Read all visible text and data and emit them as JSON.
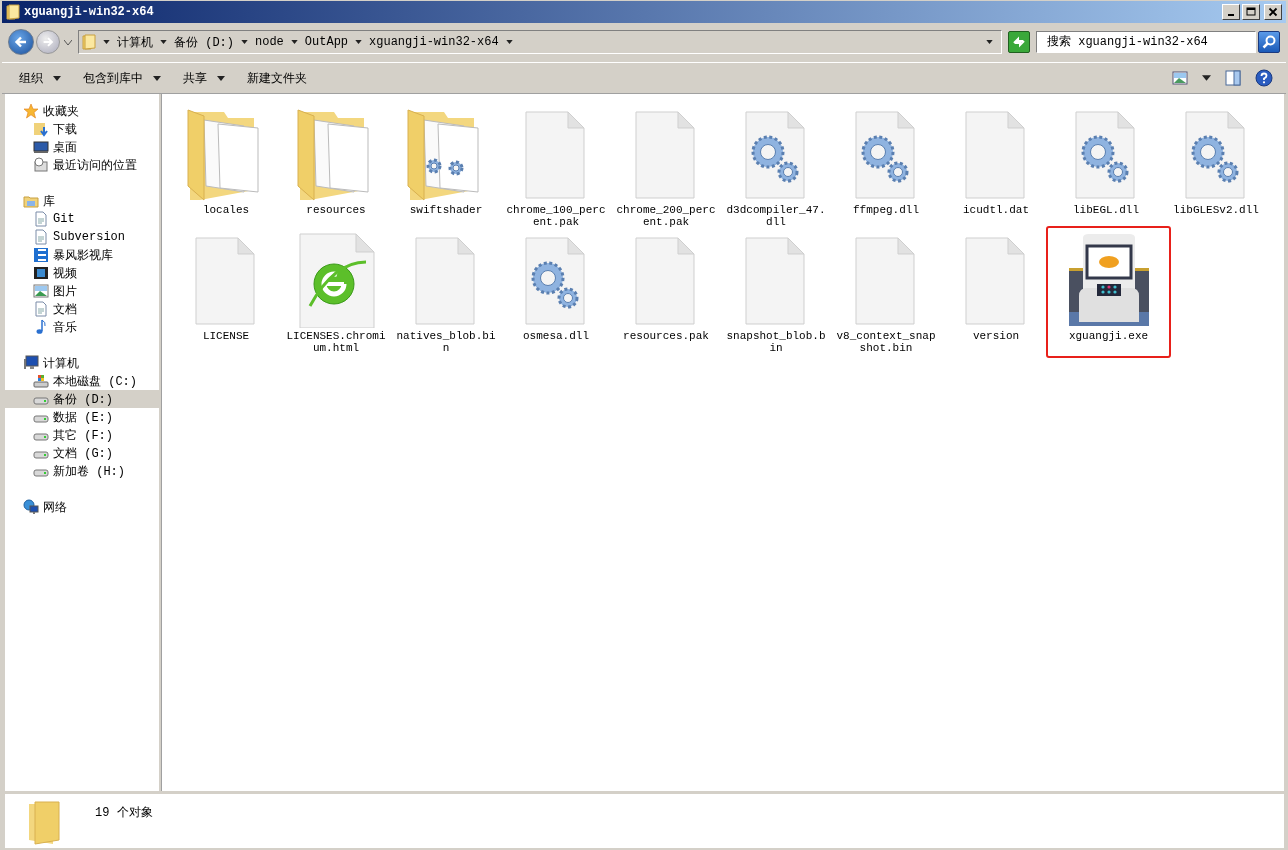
{
  "window": {
    "title": "xguangji-win32-x64"
  },
  "address_bar": {
    "segments": [
      "计算机",
      "备份 (D:)",
      "node",
      "OutApp",
      "xguangji-win32-x64"
    ]
  },
  "search": {
    "placeholder": "搜索 xguangji-win32-x64"
  },
  "toolbar": [
    {
      "label": "组织",
      "has_menu": true
    },
    {
      "label": "包含到库中",
      "has_menu": true
    },
    {
      "label": "共享",
      "has_menu": true
    },
    {
      "label": "新建文件夹",
      "has_menu": false
    }
  ],
  "sidebar": [
    {
      "label": "收藏夹",
      "kind": "star",
      "selected": false,
      "children": [
        {
          "label": "下载",
          "kind": "download",
          "selected": false
        },
        {
          "label": "桌面",
          "kind": "desktop",
          "selected": false
        },
        {
          "label": "最近访问的位置",
          "kind": "recent",
          "selected": false
        }
      ]
    },
    {
      "label": "库",
      "kind": "library",
      "selected": false,
      "children": [
        {
          "label": "Git",
          "kind": "doc",
          "selected": false
        },
        {
          "label": "Subversion",
          "kind": "doc",
          "selected": false
        },
        {
          "label": "暴风影视库",
          "kind": "media",
          "selected": false
        },
        {
          "label": "视频",
          "kind": "video",
          "selected": false
        },
        {
          "label": "图片",
          "kind": "picture",
          "selected": false
        },
        {
          "label": "文档",
          "kind": "doc",
          "selected": false
        },
        {
          "label": "音乐",
          "kind": "music",
          "selected": false
        }
      ]
    },
    {
      "label": "计算机",
      "kind": "computer",
      "selected": false,
      "children": [
        {
          "label": "本地磁盘 (C:)",
          "kind": "system_drive",
          "selected": false
        },
        {
          "label": "备份 (D:)",
          "kind": "drive",
          "selected": true
        },
        {
          "label": "数据 (E:)",
          "kind": "drive",
          "selected": false
        },
        {
          "label": "其它 (F:)",
          "kind": "drive",
          "selected": false
        },
        {
          "label": "文档 (G:)",
          "kind": "drive",
          "selected": false
        },
        {
          "label": "新加卷 (H:)",
          "kind": "drive",
          "selected": false
        }
      ]
    },
    {
      "label": "网络",
      "kind": "network",
      "selected": false
    }
  ],
  "files": [
    {
      "name": "locales",
      "kind": "folder",
      "highlighted": false
    },
    {
      "name": "resources",
      "kind": "folder",
      "highlighted": false
    },
    {
      "name": "swiftshader",
      "kind": "folder_gears",
      "highlighted": false
    },
    {
      "name": "chrome_100_percent.pak",
      "kind": "blank",
      "highlighted": false
    },
    {
      "name": "chrome_200_percent.pak",
      "kind": "blank",
      "highlighted": false
    },
    {
      "name": "d3dcompiler_47.dll",
      "kind": "gears",
      "highlighted": false
    },
    {
      "name": "ffmpeg.dll",
      "kind": "gears",
      "highlighted": false
    },
    {
      "name": "icudtl.dat",
      "kind": "blank",
      "highlighted": false
    },
    {
      "name": "libEGL.dll",
      "kind": "gears",
      "highlighted": false
    },
    {
      "name": "libGLESv2.dll",
      "kind": "gears",
      "highlighted": false
    },
    {
      "name": "LICENSE",
      "kind": "blank",
      "highlighted": false
    },
    {
      "name": "LICENSES.chromium.html",
      "kind": "web",
      "highlighted": false
    },
    {
      "name": "natives_blob.bin",
      "kind": "blank",
      "highlighted": false
    },
    {
      "name": "osmesa.dll",
      "kind": "gears",
      "highlighted": false
    },
    {
      "name": "resources.pak",
      "kind": "blank",
      "highlighted": false
    },
    {
      "name": "snapshot_blob.bin",
      "kind": "blank",
      "highlighted": false
    },
    {
      "name": "v8_context_snapshot.bin",
      "kind": "blank",
      "highlighted": false
    },
    {
      "name": "version",
      "kind": "blank",
      "highlighted": false
    },
    {
      "name": "xguangji.exe",
      "kind": "app",
      "highlighted": true
    }
  ],
  "status_bar": {
    "count": "19 个对象"
  }
}
